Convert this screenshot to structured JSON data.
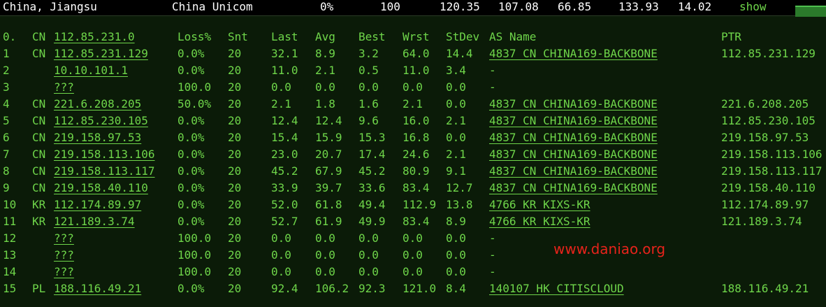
{
  "top": {
    "location": "China, Jiangsu",
    "isp": "China Unicom",
    "loss": "0%",
    "sent": "100",
    "last": "120.35",
    "avg": "107.08",
    "best": "66.85",
    "worst": "133.93",
    "stdev": "14.02",
    "show_label": "show"
  },
  "headers": {
    "hop": "0.",
    "cc": "CN",
    "host": "112.85.231.0",
    "loss": "Loss%",
    "snt": "Snt",
    "last": "Last",
    "avg": "Avg",
    "best": "Best",
    "wrst": "Wrst",
    "stdev": "StDev",
    "as": "AS Name",
    "ptr": "PTR"
  },
  "hops": [
    {
      "hop": "1",
      "cc": "CN",
      "host": "112.85.231.129",
      "loss": "0.0%",
      "snt": "20",
      "last": "32.1",
      "avg": "8.9",
      "best": "3.2",
      "wrst": "64.0",
      "stdev": "14.4",
      "as": "4837  CN CHINA169-BACKBONE",
      "ptr": "112.85.231.129"
    },
    {
      "hop": "2",
      "cc": "",
      "host": "10.10.101.1",
      "loss": "0.0%",
      "snt": "20",
      "last": "11.0",
      "avg": "2.1",
      "best": "0.5",
      "wrst": "11.0",
      "stdev": "3.4",
      "as": "-",
      "ptr": ""
    },
    {
      "hop": "3",
      "cc": "",
      "host": "???",
      "loss": "100.0",
      "snt": "20",
      "last": "0.0",
      "avg": "0.0",
      "best": "0.0",
      "wrst": "0.0",
      "stdev": "0.0",
      "as": "-",
      "ptr": ""
    },
    {
      "hop": "4",
      "cc": "CN",
      "host": "221.6.208.205",
      "loss": "50.0%",
      "snt": "20",
      "last": "2.1",
      "avg": "1.8",
      "best": "1.6",
      "wrst": "2.1",
      "stdev": "0.0",
      "as": "4837  CN CHINA169-BACKBONE",
      "ptr": "221.6.208.205"
    },
    {
      "hop": "5",
      "cc": "CN",
      "host": "112.85.230.105",
      "loss": "0.0%",
      "snt": "20",
      "last": "12.4",
      "avg": "12.4",
      "best": "9.6",
      "wrst": "16.0",
      "stdev": "2.1",
      "as": "4837  CN CHINA169-BACKBONE",
      "ptr": "112.85.230.105"
    },
    {
      "hop": "6",
      "cc": "CN",
      "host": "219.158.97.53",
      "loss": "0.0%",
      "snt": "20",
      "last": "15.4",
      "avg": "15.9",
      "best": "15.3",
      "wrst": "16.8",
      "stdev": "0.0",
      "as": "4837  CN CHINA169-BACKBONE",
      "ptr": "219.158.97.53"
    },
    {
      "hop": "7",
      "cc": "CN",
      "host": "219.158.113.106",
      "loss": "0.0%",
      "snt": "20",
      "last": "23.0",
      "avg": "20.7",
      "best": "17.4",
      "wrst": "24.6",
      "stdev": "2.1",
      "as": "4837  CN CHINA169-BACKBONE",
      "ptr": "219.158.113.106"
    },
    {
      "hop": "8",
      "cc": "CN",
      "host": "219.158.113.117",
      "loss": "0.0%",
      "snt": "20",
      "last": "45.2",
      "avg": "67.9",
      "best": "45.2",
      "wrst": "80.9",
      "stdev": "9.1",
      "as": "4837  CN CHINA169-BACKBONE",
      "ptr": "219.158.113.117"
    },
    {
      "hop": "9",
      "cc": "CN",
      "host": "219.158.40.110",
      "loss": "0.0%",
      "snt": "20",
      "last": "33.9",
      "avg": "39.7",
      "best": "33.6",
      "wrst": "83.4",
      "stdev": "12.7",
      "as": "4837  CN CHINA169-BACKBONE",
      "ptr": "219.158.40.110"
    },
    {
      "hop": "10",
      "cc": "KR",
      "host": "112.174.89.97",
      "loss": "0.0%",
      "snt": "20",
      "last": "52.0",
      "avg": "61.8",
      "best": "49.4",
      "wrst": "112.9",
      "stdev": "13.8",
      "as": "4766  KR KIXS-KR",
      "ptr": "112.174.89.97"
    },
    {
      "hop": "11",
      "cc": "KR",
      "host": "121.189.3.74",
      "loss": "0.0%",
      "snt": "20",
      "last": "52.7",
      "avg": "61.9",
      "best": "49.9",
      "wrst": "83.4",
      "stdev": "8.9",
      "as": "4766  KR KIXS-KR",
      "ptr": "121.189.3.74"
    },
    {
      "hop": "12",
      "cc": "",
      "host": "???",
      "loss": "100.0",
      "snt": "20",
      "last": "0.0",
      "avg": "0.0",
      "best": "0.0",
      "wrst": "0.0",
      "stdev": "0.0",
      "as": "-",
      "ptr": ""
    },
    {
      "hop": "13",
      "cc": "",
      "host": "???",
      "loss": "100.0",
      "snt": "20",
      "last": "0.0",
      "avg": "0.0",
      "best": "0.0",
      "wrst": "0.0",
      "stdev": "0.0",
      "as": "-",
      "ptr": ""
    },
    {
      "hop": "14",
      "cc": "",
      "host": "???",
      "loss": "100.0",
      "snt": "20",
      "last": "0.0",
      "avg": "0.0",
      "best": "0.0",
      "wrst": "0.0",
      "stdev": "0.0",
      "as": "-",
      "ptr": ""
    },
    {
      "hop": "15",
      "cc": "PL",
      "host": "188.116.49.21",
      "loss": "0.0%",
      "snt": "20",
      "last": "92.4",
      "avg": "106.2",
      "best": "92.3",
      "wrst": "121.0",
      "stdev": "8.4",
      "as": "140107 HK CITISCLOUD",
      "ptr": "188.116.49.21"
    }
  ],
  "watermark": "www.daniao.org",
  "colors": {
    "background": "#0b1b08",
    "text": "#6fd64a",
    "topbar_text": "#ffffff",
    "watermark": "#e8231b"
  }
}
